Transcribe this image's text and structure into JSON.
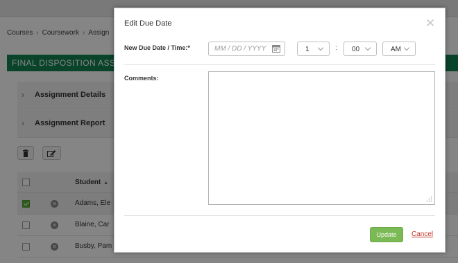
{
  "breadcrumb": [
    "Courses",
    "Coursework",
    "Assign"
  ],
  "page": {
    "title": "FINAL DISPOSITION ASSIG",
    "sections": [
      "Assignment Details",
      "Assignment Report"
    ]
  },
  "table": {
    "header_student": "Student",
    "rows": [
      {
        "name": "Adams, Ele",
        "checked": true
      },
      {
        "name": "Blaine, Car",
        "checked": false
      },
      {
        "name": "Busby, Pam",
        "checked": false
      }
    ]
  },
  "modal": {
    "title": "Edit Due Date",
    "due_label": "New Due Date / Time:*",
    "date_placeholder": "MM / DD / YYYY",
    "hour": "1",
    "minute": "00",
    "ampm": "AM",
    "colon": ":",
    "comments_label": "Comments:",
    "update_label": "Update",
    "cancel_label": "Cancel"
  },
  "icons": {
    "close": "close-icon",
    "calendar": "calendar-icon",
    "trash": "trash-icon",
    "edit": "edit-icon",
    "remove": "remove-icon",
    "chevron_right": "chevron-right-icon",
    "chevron_down": "chevron-down-icon",
    "sort_up": "sort-up-icon"
  },
  "colors": {
    "brand_green": "#138051",
    "update_green": "#7ab954",
    "cancel_red": "#c0392b",
    "checkbox_green": "#5aab38"
  }
}
